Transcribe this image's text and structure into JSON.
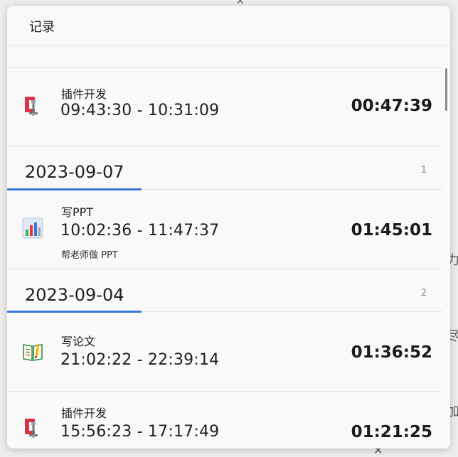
{
  "panel": {
    "title": "记录"
  },
  "background": {
    "fragments": [
      "力",
      "尽",
      "加"
    ]
  },
  "entries": [
    {
      "name": "插件开发",
      "range": "09:43:30 - 10:31:09",
      "duration": "00:47:39",
      "note": "",
      "icon": "clamp-icon"
    },
    {
      "date": "2023-09-07",
      "index": "1"
    },
    {
      "name": "写PPT",
      "range": "10:02:36 - 11:47:37",
      "duration": "01:45:01",
      "note": "帮老师做 PPT",
      "icon": "bar-chart-icon"
    },
    {
      "date": "2023-09-04",
      "index": "2"
    },
    {
      "name": "写论文",
      "range": "21:02:22 - 22:39:14",
      "duration": "01:36:52",
      "note": "",
      "icon": "notebook-icon"
    },
    {
      "name": "插件开发",
      "range": "15:56:23 - 17:17:49",
      "duration": "01:21:25",
      "note": "",
      "icon": "clamp-icon"
    }
  ],
  "colors": {
    "accent": "#3a78d8",
    "clamp_red": "#d8344a",
    "panel_bg": "#f9f9f9"
  }
}
